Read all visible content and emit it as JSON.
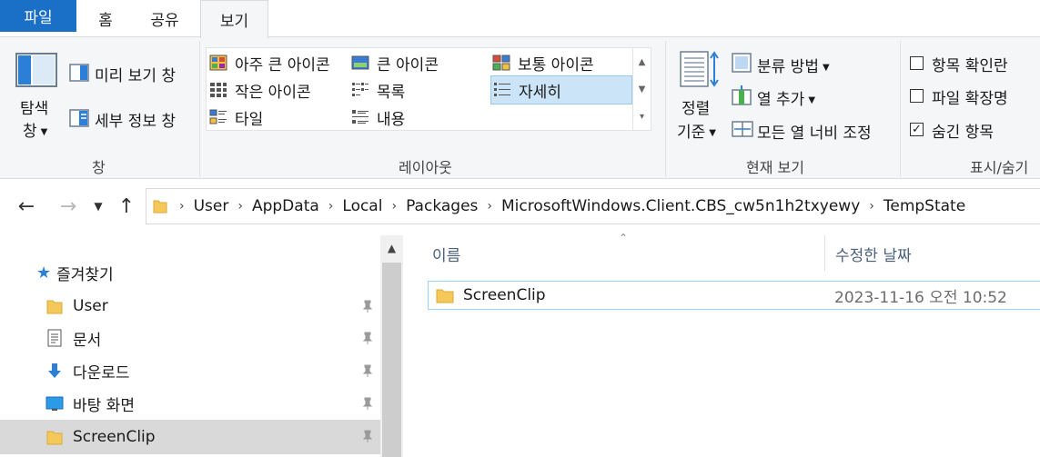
{
  "tabs": {
    "file": "파일",
    "home": "홈",
    "share": "공유",
    "view": "보기"
  },
  "ribbon": {
    "pane_group": {
      "nav_pane_line1": "탐색",
      "nav_pane_line2": "창",
      "preview_pane": "미리 보기 창",
      "details_pane": "세부 정보 창",
      "label": "창"
    },
    "layout_group": {
      "items": [
        "아주 큰 아이콘",
        "큰 아이콘",
        "보통 아이콘",
        "작은 아이콘",
        "목록",
        "자세히",
        "타일",
        "내용"
      ],
      "selected": "자세히",
      "label": "레이아웃"
    },
    "current_view_group": {
      "sort_line1": "정렬",
      "sort_line2": "기준",
      "group_by": "분류 방법",
      "add_column": "열 추가",
      "size_columns": "모든 열 너비 조정",
      "label": "현재 보기"
    },
    "show_hide_group": {
      "item_checkboxes": "항목 확인란",
      "file_extensions": "파일 확장명",
      "hidden_items": "숨긴 항목",
      "hidden_items_checked": true,
      "label": "표시/숨기"
    }
  },
  "address": {
    "crumbs": [
      "User",
      "AppData",
      "Local",
      "Packages",
      "MicrosoftWindows.Client.CBS_cw5n1h2txyewy",
      "TempState"
    ]
  },
  "nav_pane": {
    "quick_access": "즐겨찾기",
    "items": [
      {
        "label": "User",
        "icon": "folder-icon",
        "pinned": true
      },
      {
        "label": "문서",
        "icon": "documents-icon",
        "pinned": true
      },
      {
        "label": "다운로드",
        "icon": "downloads-icon",
        "pinned": true
      },
      {
        "label": "바탕 화면",
        "icon": "desktop-icon",
        "pinned": true
      },
      {
        "label": "ScreenClip",
        "icon": "folder-icon",
        "pinned": true,
        "selected": true
      }
    ]
  },
  "file_list": {
    "columns": {
      "name": "이름",
      "modified": "수정한 날짜"
    },
    "rows": [
      {
        "name": "ScreenClip",
        "modified": "2023-11-16 오전 10:52",
        "type": "folder"
      }
    ]
  },
  "colors": {
    "accent": "#1a6fc7",
    "ribbon_bg": "#f5f6f7",
    "selection": "#cce4f7",
    "folder": "#f5c85a"
  }
}
